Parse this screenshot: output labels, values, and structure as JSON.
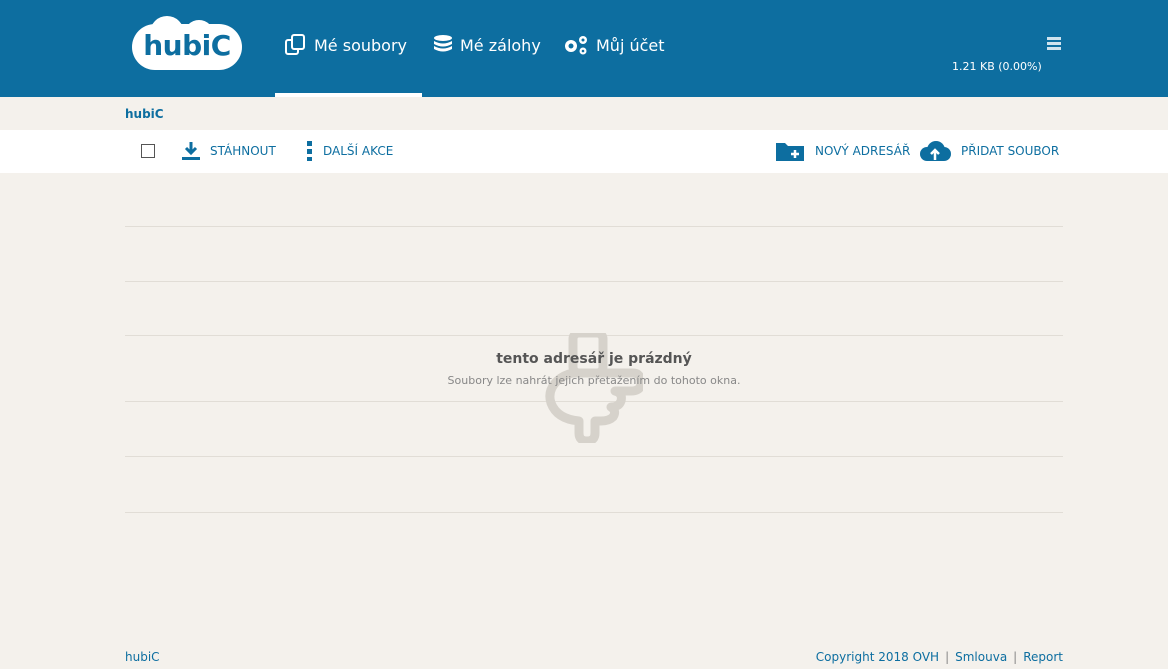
{
  "app": {
    "logo_text": "hubiC",
    "brand_color": "#0d6ea0"
  },
  "nav": {
    "items": [
      {
        "label": "Mé soubory",
        "icon": "files-icon",
        "active": true
      },
      {
        "label": "Mé zálohy",
        "icon": "database-icon",
        "active": false
      },
      {
        "label": "Můj účet",
        "icon": "gears-icon",
        "active": false
      }
    ]
  },
  "storage": {
    "usage": "1.21 KB (0.00%)"
  },
  "breadcrumb": {
    "root": "hubiC"
  },
  "toolbar": {
    "download_label": "STÁHNOUT",
    "more_label": "DALŠÍ AKCE",
    "new_folder_label": "NOVÝ ADRESÁŘ",
    "add_file_label": "PŘIDAT SOUBOR"
  },
  "empty_state": {
    "title": "tento adresář je prázdný",
    "subtitle": "Soubory lze nahrát jejich přetažením do tohoto okna."
  },
  "footer": {
    "left": "hubiC",
    "copyright": "Copyright 2018 OVH",
    "contract": "Smlouva",
    "report": "Report"
  }
}
